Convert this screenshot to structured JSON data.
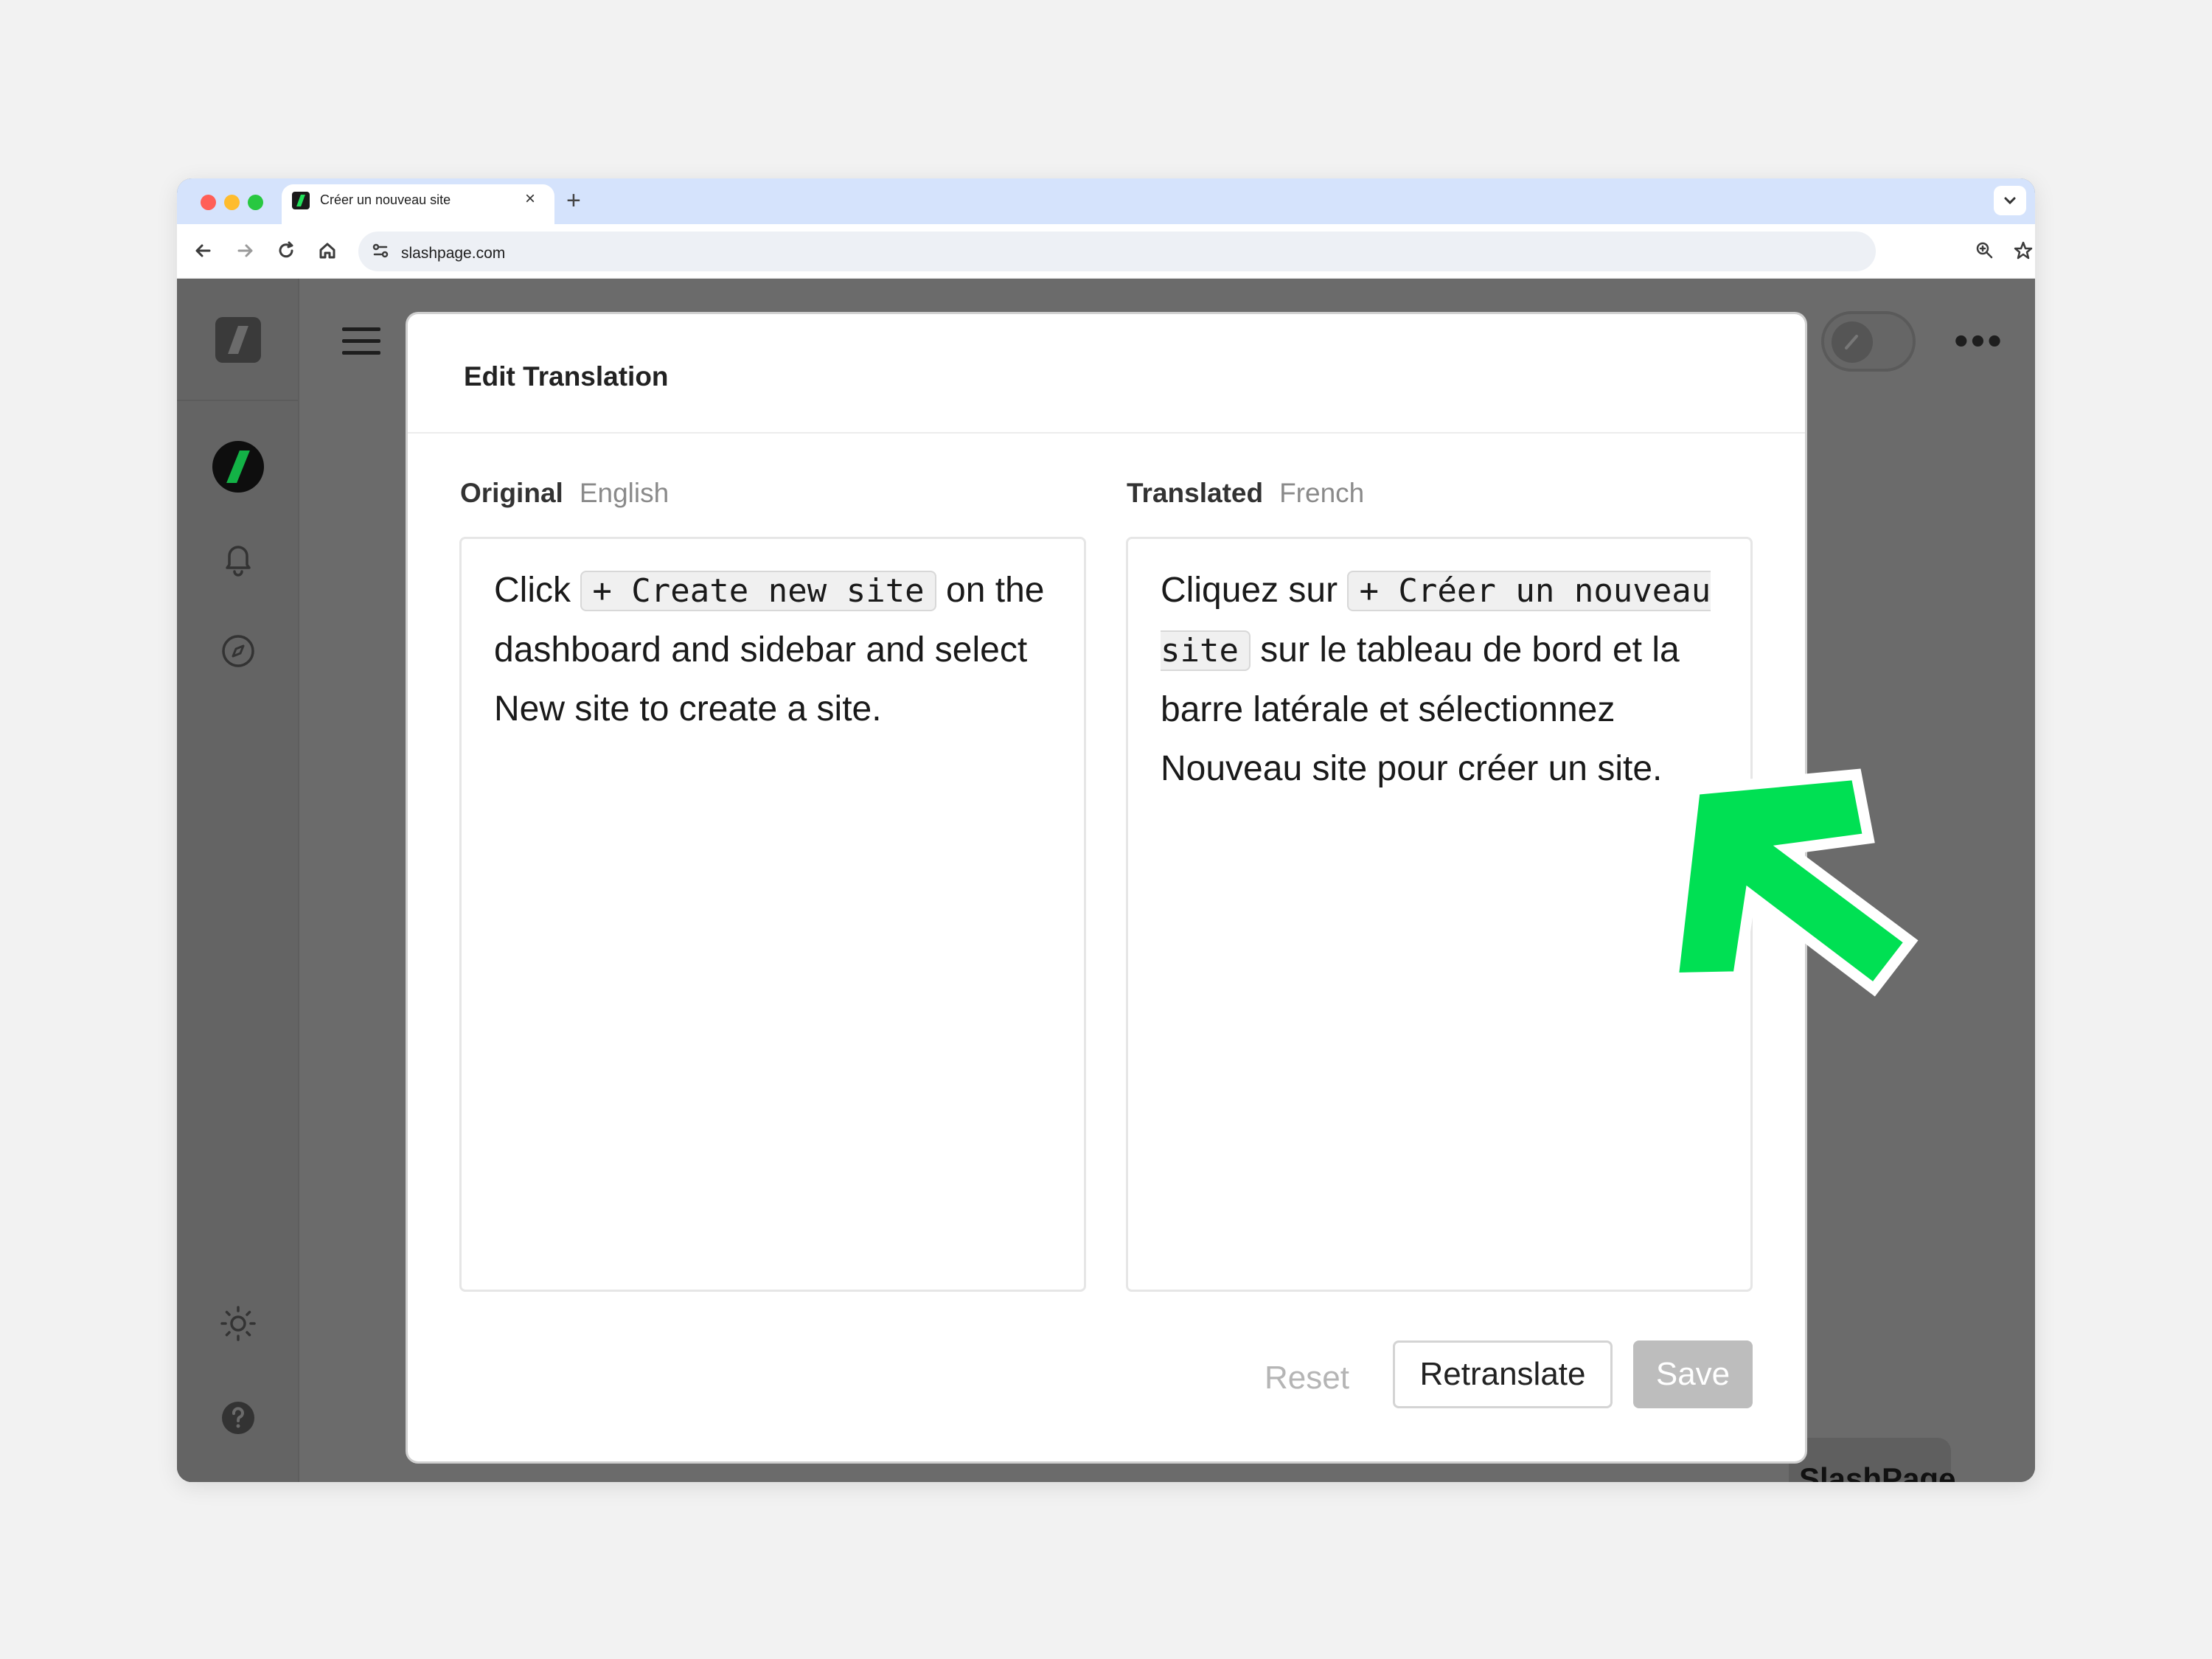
{
  "browser": {
    "tab_title": "Créer un nouveau site",
    "tab_close": "×",
    "new_tab": "+",
    "url": "slashpage.com"
  },
  "app": {
    "more_label": "•••",
    "brand_name": "SlashPage"
  },
  "dialog": {
    "title": "Edit Translation",
    "original": {
      "label": "Original",
      "language": "English",
      "text_before": "Click ",
      "code": "+ Create new site",
      "text_after": " on the dashboard and sidebar and select New site to create a site."
    },
    "translated": {
      "label": "Translated",
      "language": "French",
      "text_before": "Cliquez sur ",
      "code": "+ Créer un nouveau site",
      "text_after": " sur le tableau de bord et la barre latérale et sélectionnez Nouveau site pour créer un site."
    },
    "buttons": {
      "reset": "Reset",
      "retranslate": "Retranslate",
      "save": "Save"
    }
  },
  "colors": {
    "accent_arrow": "#00e053",
    "overlay": "#6b6b6b",
    "save_disabled": "#bdbdbd"
  },
  "icons": [
    "back-icon",
    "forward-icon",
    "reload-icon",
    "home-icon",
    "site-settings-icon",
    "zoom-icon",
    "bookmark-star-icon",
    "extensions-icon",
    "profile-icon",
    "menu-kebab-icon",
    "bell-icon",
    "compass-icon",
    "sun-icon",
    "help-icon",
    "hamburger-icon",
    "pencil-icon"
  ]
}
